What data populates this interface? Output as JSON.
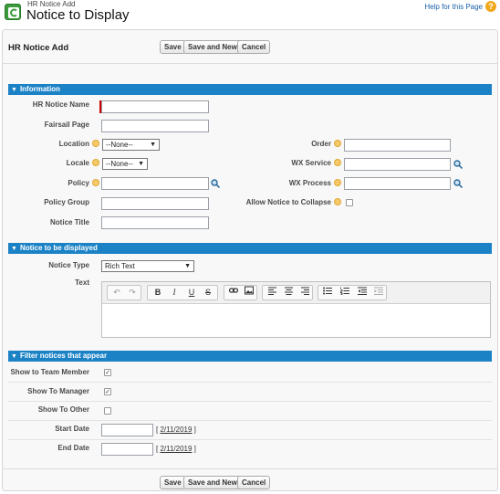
{
  "header": {
    "subtitle": "HR Notice Add",
    "title": "Notice to Display",
    "help_link": "Help for this Page",
    "help_icon": "?"
  },
  "page_block": {
    "title": "HR Notice Add",
    "buttons": {
      "save": "Save",
      "save_new": "Save and New",
      "cancel": "Cancel"
    }
  },
  "sections": {
    "information": {
      "title": "Information",
      "fields": {
        "hr_notice_name": {
          "label": "HR Notice Name",
          "value": ""
        },
        "fairsail_page": {
          "label": "Fairsail Page",
          "value": ""
        },
        "location": {
          "label": "Location",
          "value": "--None--"
        },
        "locale": {
          "label": "Locale",
          "value": "--None--"
        },
        "policy": {
          "label": "Policy",
          "value": ""
        },
        "policy_group": {
          "label": "Policy Group",
          "value": ""
        },
        "notice_title": {
          "label": "Notice Title",
          "value": ""
        },
        "order": {
          "label": "Order",
          "value": ""
        },
        "wx_service": {
          "label": "WX Service",
          "value": ""
        },
        "wx_process": {
          "label": "WX Process",
          "value": ""
        },
        "allow_collapse": {
          "label": "Allow Notice to Collapse",
          "checked": false
        }
      }
    },
    "notice_display": {
      "title": "Notice to be displayed",
      "notice_type": {
        "label": "Notice Type",
        "value": "Rich Text"
      },
      "text": {
        "label": "Text",
        "value": ""
      },
      "toolbar_icons": [
        "undo-icon",
        "redo-icon",
        "bold-icon",
        "italic-icon",
        "underline-icon",
        "strikethrough-icon",
        "link-icon",
        "image-icon",
        "align-left-icon",
        "align-center-icon",
        "align-right-icon",
        "bulleted-list-icon",
        "numbered-list-icon",
        "outdent-icon",
        "indent-icon"
      ],
      "toolbar_glyphs": {
        "undo": "↶",
        "redo": "↷",
        "bold": "B",
        "italic": "I",
        "underline": "U",
        "strike": "S"
      }
    },
    "filter": {
      "title": "Filter notices that appear",
      "show_team_member": {
        "label": "Show to Team Member",
        "checked": true
      },
      "show_manager": {
        "label": "Show To Manager",
        "checked": true
      },
      "show_other": {
        "label": "Show To Other",
        "checked": false
      },
      "start_date": {
        "label": "Start Date",
        "value": "",
        "today_link": "2/11/2019"
      },
      "end_date": {
        "label": "End Date",
        "value": "",
        "today_link": "2/11/2019"
      }
    }
  },
  "footer_buttons": {
    "save": "Save",
    "save_new": "Save and New",
    "cancel": "Cancel"
  },
  "colors": {
    "section_header": "#1b82c6",
    "required": "#cc0000",
    "help_icon": "#f0a81c",
    "link": "#1a5fa8"
  }
}
